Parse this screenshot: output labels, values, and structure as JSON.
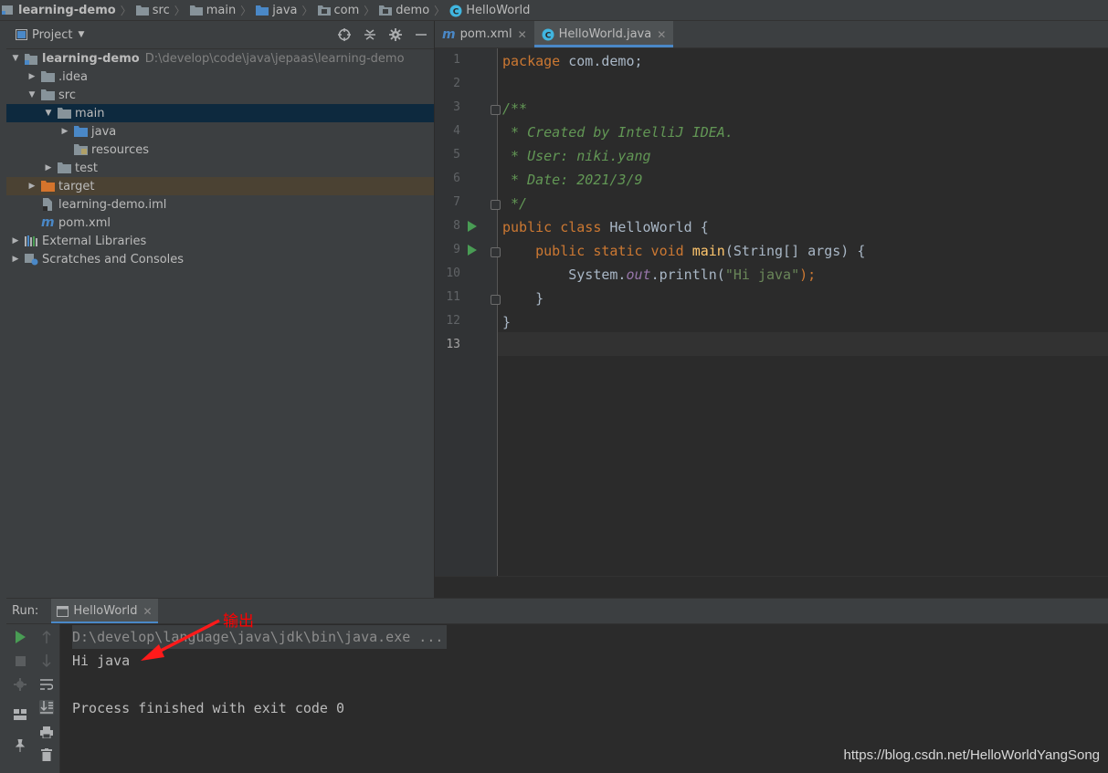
{
  "breadcrumb": {
    "items": [
      "learning-demo",
      "src",
      "main",
      "java",
      "com",
      "demo",
      "HelloWorld"
    ]
  },
  "project_panel": {
    "title": "Project",
    "tree": [
      {
        "label": "learning-demo",
        "path": "D:\\develop\\code\\java\\jepaas\\learning-demo"
      },
      {
        "label": ".idea"
      },
      {
        "label": "src"
      },
      {
        "label": "main"
      },
      {
        "label": "java"
      },
      {
        "label": "resources"
      },
      {
        "label": "test"
      },
      {
        "label": "target"
      },
      {
        "label": "learning-demo.iml"
      },
      {
        "label": "pom.xml"
      },
      {
        "label": "External Libraries"
      },
      {
        "label": "Scratches and Consoles"
      }
    ]
  },
  "editor": {
    "tabs": [
      {
        "label": "pom.xml",
        "active": false
      },
      {
        "label": "HelloWorld.java",
        "active": true
      }
    ],
    "line_numbers": [
      "1",
      "2",
      "3",
      "4",
      "5",
      "6",
      "7",
      "8",
      "9",
      "10",
      "11",
      "12",
      "13"
    ],
    "current_line": "13",
    "code": {
      "l1_kw": "package",
      "l1_rest": " com.demo;",
      "l3": "/**",
      "l4": " * Created by IntelliJ IDEA.",
      "l5": " * User: niki.yang",
      "l6": " * Date: 2021/3/9",
      "l7": " */",
      "l8_kw": "public class",
      "l8_rest": " HelloWorld {",
      "l9_indent": "    ",
      "l9_kw": "public static void",
      "l9_fn": " main",
      "l9_rest": "(String[] args) {",
      "l10_indent": "        System.",
      "l10_field": "out",
      "l10_call": ".println(",
      "l10_str": "\"Hi java\"",
      "l10_end": ");",
      "l11": "    }",
      "l12": "}"
    }
  },
  "run_panel": {
    "label": "Run:",
    "tab": "HelloWorld",
    "output": [
      "D:\\develop\\language\\java\\jdk\\bin\\java.exe ...",
      "Hi java",
      "",
      "Process finished with exit code 0"
    ]
  },
  "annotation": {
    "text": "输出",
    "color": "#ff0000"
  },
  "watermark": "https://blog.csdn.net/HelloWorldYangSong",
  "colors": {
    "keyword": "#cc7832",
    "comment": "#629755",
    "string": "#6a8759",
    "function": "#ffc66d",
    "field": "#9876aa",
    "folder": "#87939a",
    "source_folder": "#4a88c7",
    "excluded_folder": "#d4742c",
    "run_green": "#499c54"
  },
  "icons": [
    "project-icon",
    "folder-icon",
    "module-icon",
    "target-folder-icon",
    "iml-file-icon",
    "maven-icon",
    "libraries-icon",
    "scratches-icon",
    "java-class-icon",
    "run-gutter-icon",
    "locate-icon",
    "collapse-icon",
    "gear-icon",
    "minimize-icon",
    "rerun-icon",
    "stop-icon",
    "scroll-up-icon",
    "scroll-down-icon",
    "soft-wrap-icon",
    "scroll-end-icon",
    "print-icon",
    "trash-icon",
    "pin-icon",
    "layout-icon"
  ]
}
